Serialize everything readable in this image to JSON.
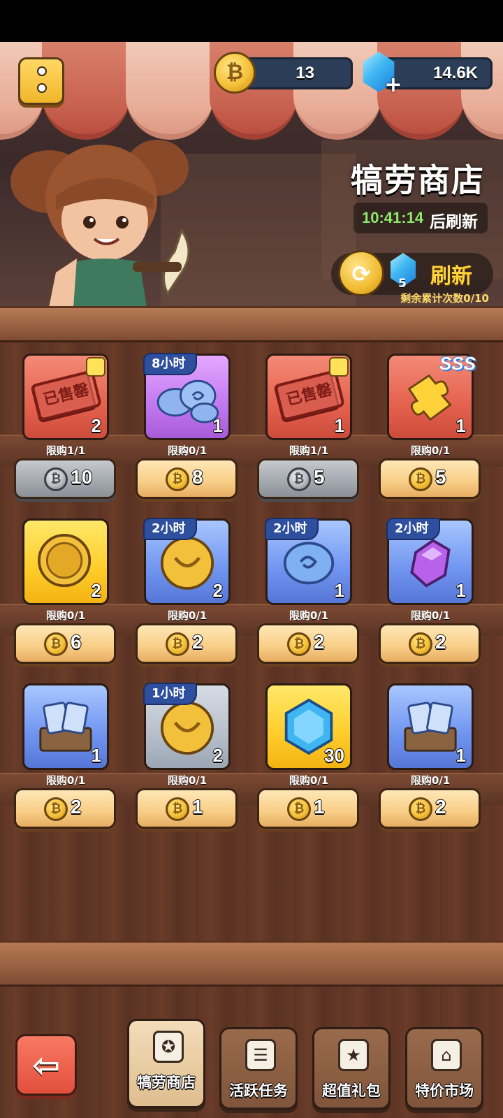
{
  "header": {
    "coin_amount": "13",
    "gem_amount": "14.6K",
    "shop_title": "犒劳商店",
    "refresh_timer": "10:41:14",
    "refresh_timer_suffix": "后刷新",
    "refresh_cost": "5",
    "refresh_label": "刷新",
    "refresh_remaining": "剩余累计次数0/10"
  },
  "rows": [
    [
      {
        "bg": "red",
        "art": "sold-ticket-icon",
        "stamp": "已售罄",
        "tag": "",
        "qty": "2",
        "limit": "限购1/1",
        "price": "10",
        "currency": "silver-coin",
        "disabled": true
      },
      {
        "bg": "purple",
        "art": "blue-swirl-stones-icon",
        "stamp": "",
        "tag": "8小时",
        "qty": "1",
        "limit": "限购0/1",
        "price": "8",
        "currency": "gold-coin",
        "disabled": false
      },
      {
        "bg": "red",
        "art": "sold-ticket-icon",
        "stamp": "已售罄",
        "tag": "",
        "qty": "1",
        "limit": "限购1/1",
        "price": "5",
        "currency": "silver-coin",
        "disabled": true
      },
      {
        "bg": "red",
        "art": "gold-puzzle-piece-icon",
        "stamp": "",
        "tag": "",
        "badge": "SSS",
        "qty": "1",
        "limit": "限购0/1",
        "price": "5",
        "currency": "gold-coin",
        "disabled": false
      }
    ],
    [
      {
        "bg": "gold",
        "art": "gold-medal-coin-icon",
        "stamp": "",
        "tag": "",
        "qty": "2",
        "limit": "限购0/1",
        "price": "6",
        "currency": "gold-coin",
        "disabled": false
      },
      {
        "bg": "blue",
        "art": "gold-smile-coin-icon",
        "stamp": "",
        "tag": "2小时",
        "qty": "2",
        "limit": "限购0/1",
        "price": "2",
        "currency": "gold-coin",
        "disabled": false
      },
      {
        "bg": "blue",
        "art": "blue-swirl-stone-icon",
        "stamp": "",
        "tag": "2小时",
        "qty": "1",
        "limit": "限购0/1",
        "price": "2",
        "currency": "gold-coin",
        "disabled": false
      },
      {
        "bg": "blue",
        "art": "purple-crystal-icon",
        "stamp": "",
        "tag": "2小时",
        "qty": "1",
        "limit": "限购0/1",
        "price": "2",
        "currency": "gold-coin",
        "disabled": false
      }
    ],
    [
      {
        "bg": "blue",
        "art": "card-chest-icon",
        "stamp": "",
        "tag": "",
        "qty": "1",
        "limit": "限购0/1",
        "price": "2",
        "currency": "gold-coin",
        "disabled": false
      },
      {
        "bg": "gray",
        "art": "gold-smile-coin-icon",
        "stamp": "",
        "tag": "1小时",
        "qty": "2",
        "limit": "限购0/1",
        "price": "1",
        "currency": "gold-coin",
        "disabled": false
      },
      {
        "bg": "gold",
        "art": "blue-gem-icon",
        "stamp": "",
        "tag": "",
        "qty": "30",
        "limit": "限购0/1",
        "price": "1",
        "currency": "gold-coin",
        "disabled": false
      },
      {
        "bg": "blue",
        "art": "card-chest-icon",
        "stamp": "",
        "tag": "",
        "qty": "1",
        "limit": "限购0/1",
        "price": "2",
        "currency": "gold-coin",
        "disabled": false
      }
    ]
  ],
  "nav": {
    "tabs": [
      {
        "label": "犒劳商店",
        "icon": "shop-badge-icon",
        "active": true
      },
      {
        "label": "活跃任务",
        "icon": "task-list-icon",
        "active": false
      },
      {
        "label": "超值礼包",
        "icon": "gift-box-icon",
        "active": false
      },
      {
        "label": "特价市场",
        "icon": "market-stall-icon",
        "active": false
      }
    ]
  },
  "colors": {
    "timer_green": "#8ee86a",
    "refresh_yellow": "#ffd43b",
    "wood_dark": "#5d3424",
    "price_button": "#f8cd86",
    "price_button_disabled": "#a3a7ae"
  }
}
